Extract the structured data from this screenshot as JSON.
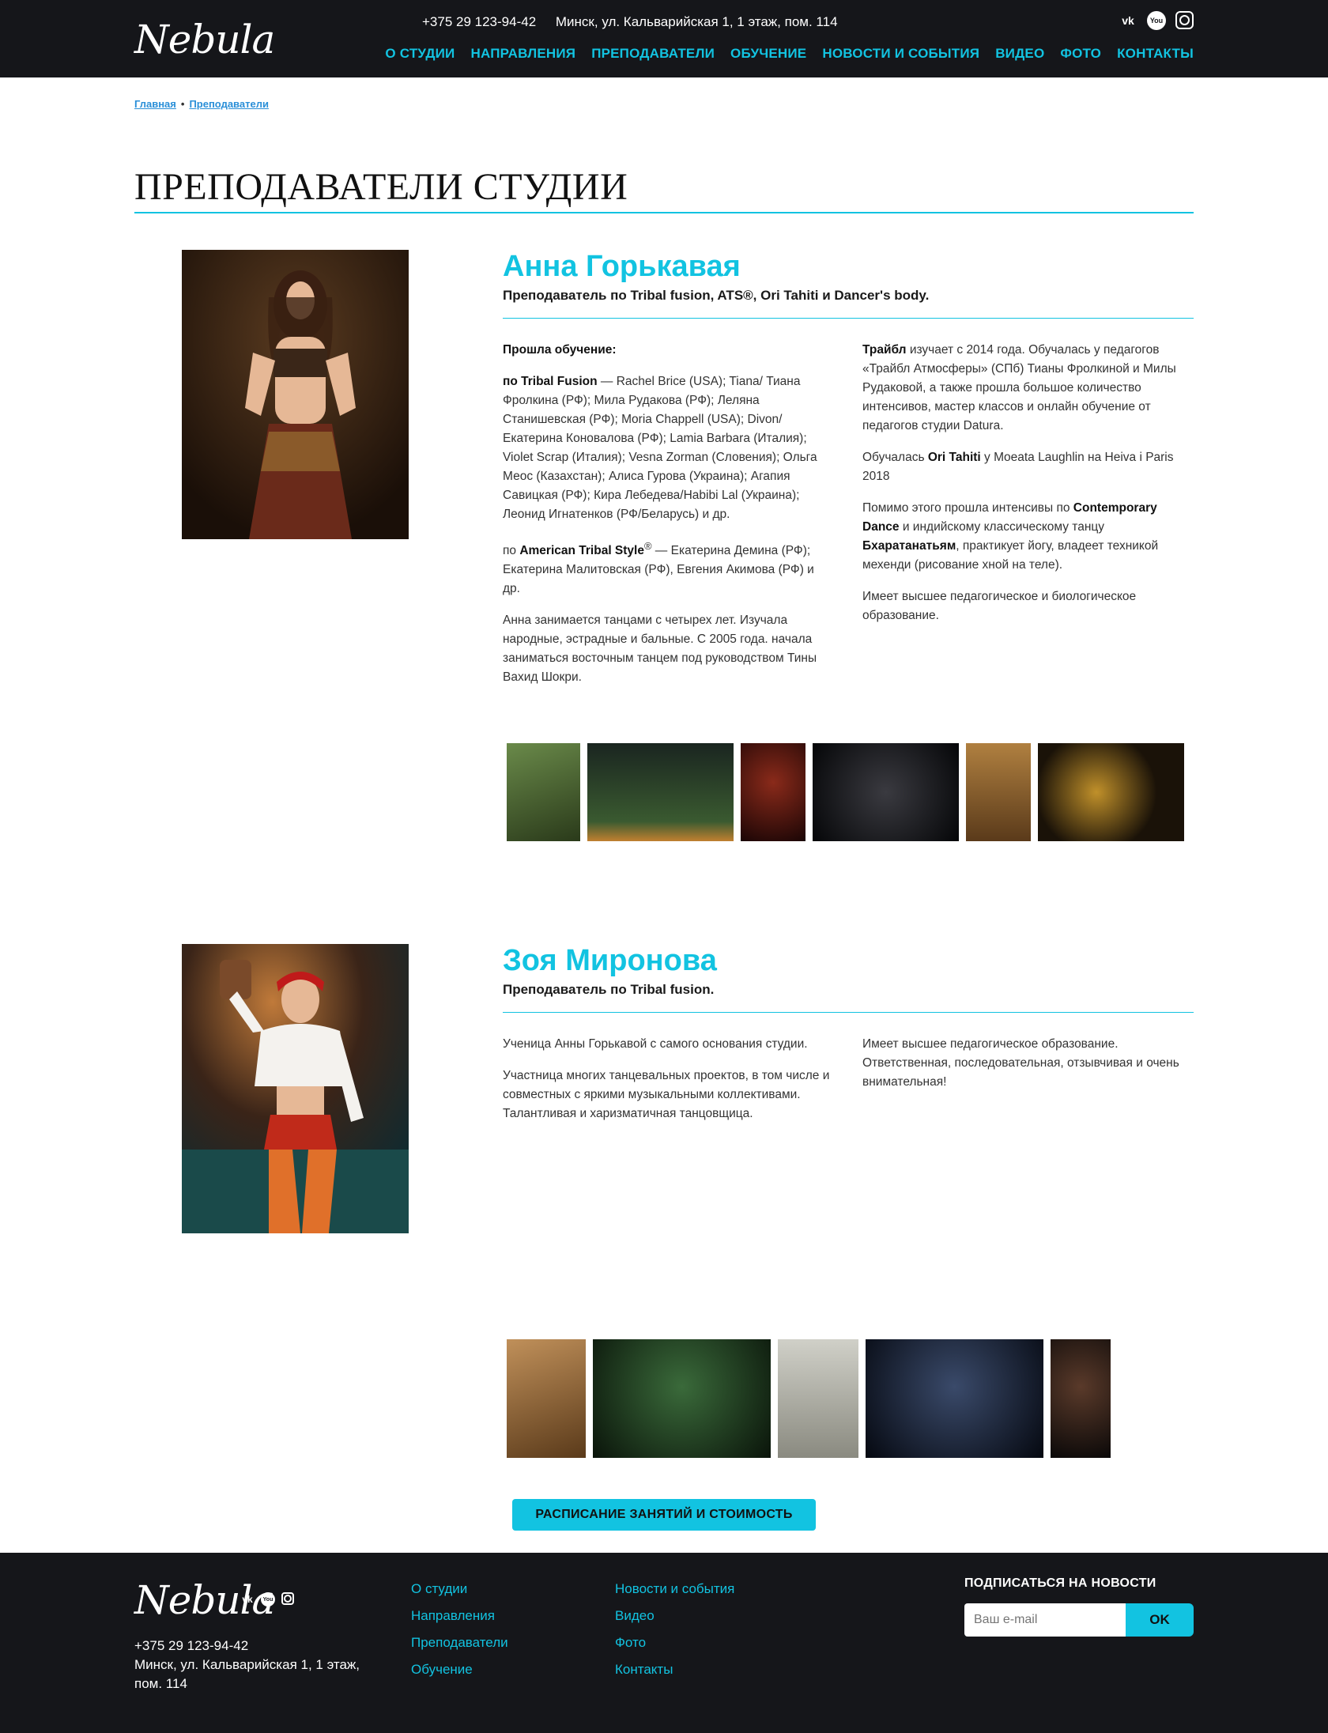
{
  "header": {
    "logo": "Nebula",
    "phone": "+375 29 123-94-42",
    "address": "Минск, ул. Кальварийская 1, 1 этаж, пом. 114",
    "social": [
      {
        "name": "vk",
        "glyph": "vk"
      },
      {
        "name": "youtube",
        "glyph": "You"
      },
      {
        "name": "instagram",
        "glyph": ""
      }
    ],
    "nav": [
      "О СТУДИИ",
      "НАПРАВЛЕНИЯ",
      "ПРЕПОДАВАТЕЛИ",
      "ОБУЧЕНИЕ",
      "НОВОСТИ И СОБЫТИЯ",
      "ВИДЕО",
      "ФОТО",
      "КОНТАКТЫ"
    ]
  },
  "breadcrumb": {
    "home": "Главная",
    "current": "Преподаватели"
  },
  "page_title": "ПРЕПОДАВАТЕЛИ СТУДИИ",
  "teachers": [
    {
      "name": "Анна Горькавая",
      "role": "Преподаватель по Tribal fusion, ATS®, Ori Tahiti и Dancer's body.",
      "col1": {
        "p1_title": "Прошла обучение:",
        "p2_bold": "по Tribal Fusion",
        "p2_text": " — Rachel Brice (USA); Tiana/ Тиана Фролкина (РФ); Мила Рудакова (РФ); Леляна Станишевская (РФ); Moria Chappell (USA); Divon/ Екатерина Коновалова (РФ); Lamia Barbara (Италия); Violet Scrap (Италия); Vesna Zorman (Словения); Ольга Меос (Казахстан); Алиса Гурова (Украина); Агапия Савицкая (РФ); Кира Лебедева/Habibi Lal (Украина); Леонид Игнатенков (РФ/Беларусь) и др.",
        "p3_pre": "по ",
        "p3_bold": "American Tribal Style",
        "p3_sup": "®",
        "p3_text": " — Екатерина Демина (РФ); Екатерина Малитовская (РФ), Евгения Акимова (РФ) и др.",
        "p4": "Анна занимается танцами с четырех лет. Изучала народные, эстрадные и бальные. С 2005 года. начала заниматься восточным танцем под руководством Тины Вахид Шокри."
      },
      "col2": {
        "p1_bold": "Трайбл",
        "p1_text": " изучает с 2014 года. Обучалась у педагогов «Трайбл Атмосферы» (СПб) Тианы Фролкиной и Милы Рудаковой, а также прошла большое количество интенсивов, мастер классов и онлайн обучение от педагогов студии Datura.",
        "p2_pre": "Обучалась ",
        "p2_bold": "Ori Tahiti",
        "p2_text": " у Moeata Laughlin на Heiva i Paris 2018",
        "p3_pre": "Помимо этого прошла интенсивы по ",
        "p3_bold1": "Contemporary Dance",
        "p3_mid": " и индийскому классическому танцу ",
        "p3_bold2": "Бхаратанатьям",
        "p3_text": ", практикует йогу, владеет техникой мехенди (рисование хной на теле).",
        "p4": "Имеет высшее педагогическое и биологическое образование."
      },
      "gallery": [
        {
          "name": "photo-1",
          "color": "#5a7a3a"
        },
        {
          "name": "photo-2",
          "color": "#1d2a22"
        },
        {
          "name": "photo-3",
          "color": "#2a0d0a"
        },
        {
          "name": "photo-4",
          "color": "#121416"
        },
        {
          "name": "photo-5",
          "color": "#7a5a2a"
        },
        {
          "name": "photo-6",
          "color": "#1a1410"
        }
      ]
    },
    {
      "name": "Зоя Миронова",
      "role": "Преподаватель по Tribal fusion.",
      "col1": {
        "p1": "Ученица Анны Горькавой с самого основания студии.",
        "p2": "Участница многих танцевальных проектов, в том числе и совместных с яркими музыкальными коллективами. Талантливая и харизматичная танцовщица."
      },
      "col2": {
        "p1": "Имеет высшее педагогическое образование. Ответственная, последовательная, отзывчивая и очень внимательная!"
      },
      "gallery": [
        {
          "name": "photo-1",
          "color": "#8a6a3e"
        },
        {
          "name": "photo-2",
          "color": "#1f3a20"
        },
        {
          "name": "photo-3",
          "color": "#b8b8b0"
        },
        {
          "name": "photo-4",
          "color": "#121a2a"
        },
        {
          "name": "photo-5",
          "color": "#1a1818"
        }
      ]
    }
  ],
  "schedule_button": "РАСПИСАНИЕ ЗАНЯТИЙ И СТОИМОСТЬ",
  "footer": {
    "logo": "Nebula",
    "phone": "+375 29 123-94-42",
    "address": "Минск, ул. Кальварийская 1, 1 этаж, пом. 114",
    "links_col1": [
      "О студии",
      "Направления",
      "Преподаватели",
      "Обучение"
    ],
    "links_col2": [
      "Новости и события",
      "Видео",
      "Фото",
      "Контакты"
    ],
    "subscribe_title": "ПОДПИСАТЬСЯ НА НОВОСТИ",
    "email_placeholder": "Ваш e-mail",
    "ok_label": "OK"
  },
  "colors": {
    "accent": "#12c3e1",
    "dark": "#15161a"
  }
}
